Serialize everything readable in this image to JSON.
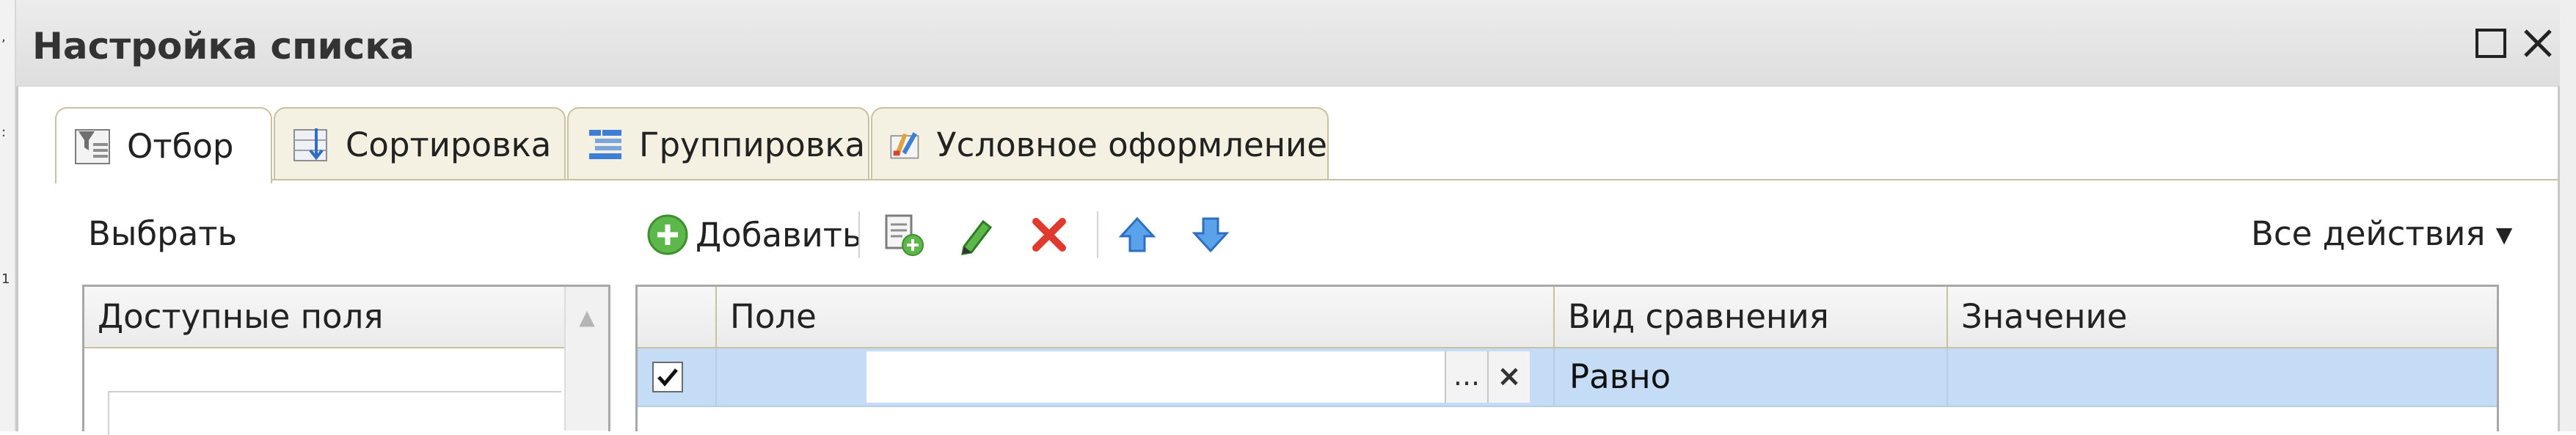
{
  "window": {
    "title": "Настройка списка"
  },
  "tabs": [
    {
      "label": "Отбор",
      "icon": "filter-icon",
      "active": true
    },
    {
      "label": "Сортировка",
      "icon": "sort-icon",
      "active": false
    },
    {
      "label": "Группировка",
      "icon": "grouping-icon",
      "active": false
    },
    {
      "label": "Условное оформление",
      "icon": "conditional-format-icon",
      "active": false
    }
  ],
  "left_panel": {
    "select_label": "Выбрать",
    "fields_header": "Доступные поля"
  },
  "toolbar": {
    "add_label": "Добавить",
    "buttons": [
      "add-icon",
      "add-group-icon",
      "edit-icon",
      "delete-icon",
      "move-up-icon",
      "move-down-icon"
    ],
    "all_actions_label": "Все действия ▾"
  },
  "filter_table": {
    "columns": [
      "Поле",
      "Вид сравнения",
      "Значение"
    ],
    "rows": [
      {
        "checked": true,
        "field": "",
        "comparison": "Равно",
        "value": ""
      }
    ],
    "field_ellipsis": "...",
    "field_clear": "×"
  },
  "colors": {
    "accent_row": "#c5dcf6",
    "tab_border": "#c9c2a0",
    "delete_red": "#e03a2f",
    "move_blue": "#3d8de0",
    "add_green": "#4aa83c"
  }
}
